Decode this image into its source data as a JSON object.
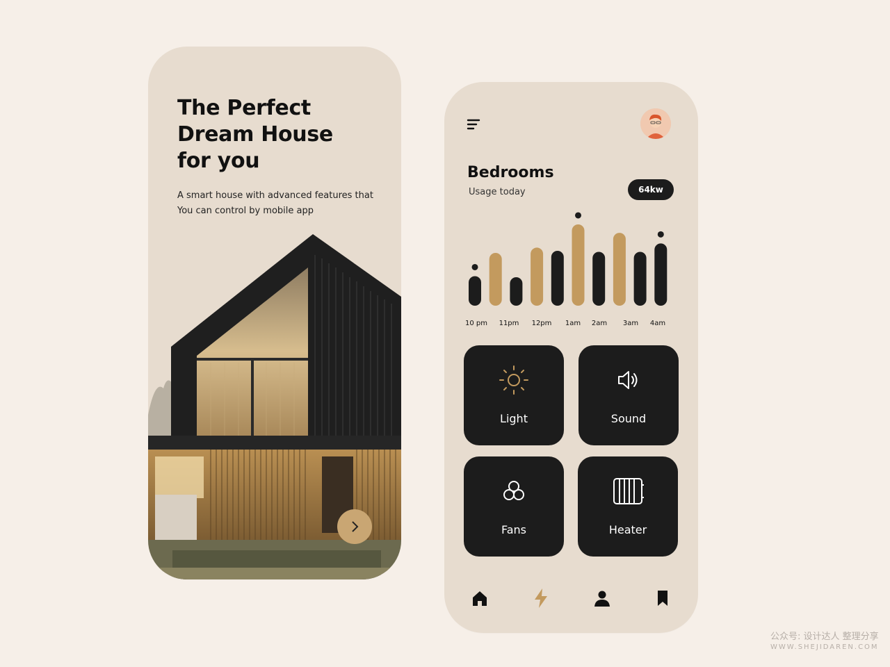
{
  "onboarding": {
    "title_lines": [
      "The Perfect",
      "Dream House",
      "for you"
    ],
    "subtitle_lines": [
      "A smart house with advanced features that",
      "You can control by mobile app"
    ],
    "next_icon": "chevron-right-icon"
  },
  "dashboard": {
    "menu_icon": "menu-icon",
    "avatar_icon": "user-avatar",
    "room_title": "Bedrooms",
    "room_subtitle": "Usage today",
    "usage_badge": "64kw",
    "controls": [
      {
        "label": "Light",
        "icon": "sun-icon"
      },
      {
        "label": "Sound",
        "icon": "speaker-icon"
      },
      {
        "label": "Fans",
        "icon": "fan-icon"
      },
      {
        "label": "Heater",
        "icon": "heater-icon"
      }
    ],
    "nav": [
      {
        "icon": "home-icon"
      },
      {
        "icon": "bolt-icon",
        "active": true
      },
      {
        "icon": "user-icon"
      },
      {
        "icon": "bookmark-icon"
      }
    ]
  },
  "chart_data": {
    "type": "bar",
    "categories": [
      "10 pm",
      "",
      "11pm",
      "",
      "12pm",
      "",
      "1am",
      "2am",
      "",
      "3am",
      "",
      "4am"
    ],
    "values": [
      0.28,
      0.5,
      0.27,
      0.55,
      0.52,
      0.77,
      0.51,
      0.69,
      0.51,
      0.59
    ],
    "colors": [
      "#1c1c1c",
      "#c39a5e",
      "#1c1c1c",
      "#c39a5e",
      "#1c1c1c",
      "#c39a5e",
      "#1c1c1c",
      "#c39a5e",
      "#1c1c1c",
      "#1c1c1c"
    ],
    "markers": [
      true,
      false,
      false,
      false,
      false,
      true,
      false,
      false,
      false,
      true
    ],
    "tick_labels": [
      "10 pm",
      "11pm",
      "12pm",
      "1am",
      "2am",
      "3am",
      "4am"
    ],
    "title": "",
    "xlabel": "",
    "ylabel": "",
    "ylim": [
      0,
      1
    ],
    "grid": false
  },
  "watermark": {
    "line1": "公众号: 设计达人 整理分享",
    "line2": "WWW.SHEJIDAREN.COM"
  },
  "colors": {
    "background": "#f6efe8",
    "phone": "#e7dccf",
    "dark": "#1c1c1c",
    "accent": "#c39a5e"
  }
}
